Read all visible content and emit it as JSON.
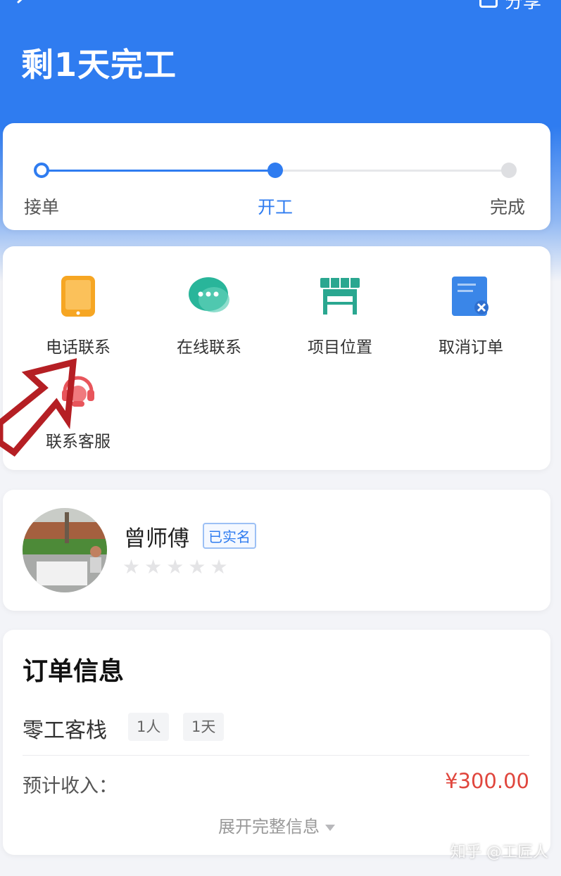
{
  "header": {
    "title": "剩1天完工",
    "share_label": "分享",
    "colors": {
      "primary": "#2f7cf0"
    }
  },
  "progress": {
    "steps": [
      {
        "label": "接单",
        "state": "completed"
      },
      {
        "label": "开工",
        "state": "current"
      },
      {
        "label": "完成",
        "state": "pending"
      }
    ]
  },
  "actions": [
    {
      "label": "电话联系",
      "icon": "phone-icon"
    },
    {
      "label": "在线联系",
      "icon": "chat-icon"
    },
    {
      "label": "项目位置",
      "icon": "location-shop-icon"
    },
    {
      "label": "取消订单",
      "icon": "cancel-document-icon"
    },
    {
      "label": "联系客服",
      "icon": "customer-service-icon"
    }
  ],
  "worker": {
    "name": "曾师傅",
    "verified_badge": "已实名",
    "rating": 0,
    "max_rating": 5
  },
  "order": {
    "section_title": "订单信息",
    "name": "零工客栈",
    "tags": [
      "1人",
      "1天"
    ],
    "income_label": "预计收入：",
    "income_value": "¥300.00",
    "expand_label": "展开完整信息",
    "colors": {
      "income": "#e0463d"
    }
  },
  "watermark": "知乎 @工匠人"
}
